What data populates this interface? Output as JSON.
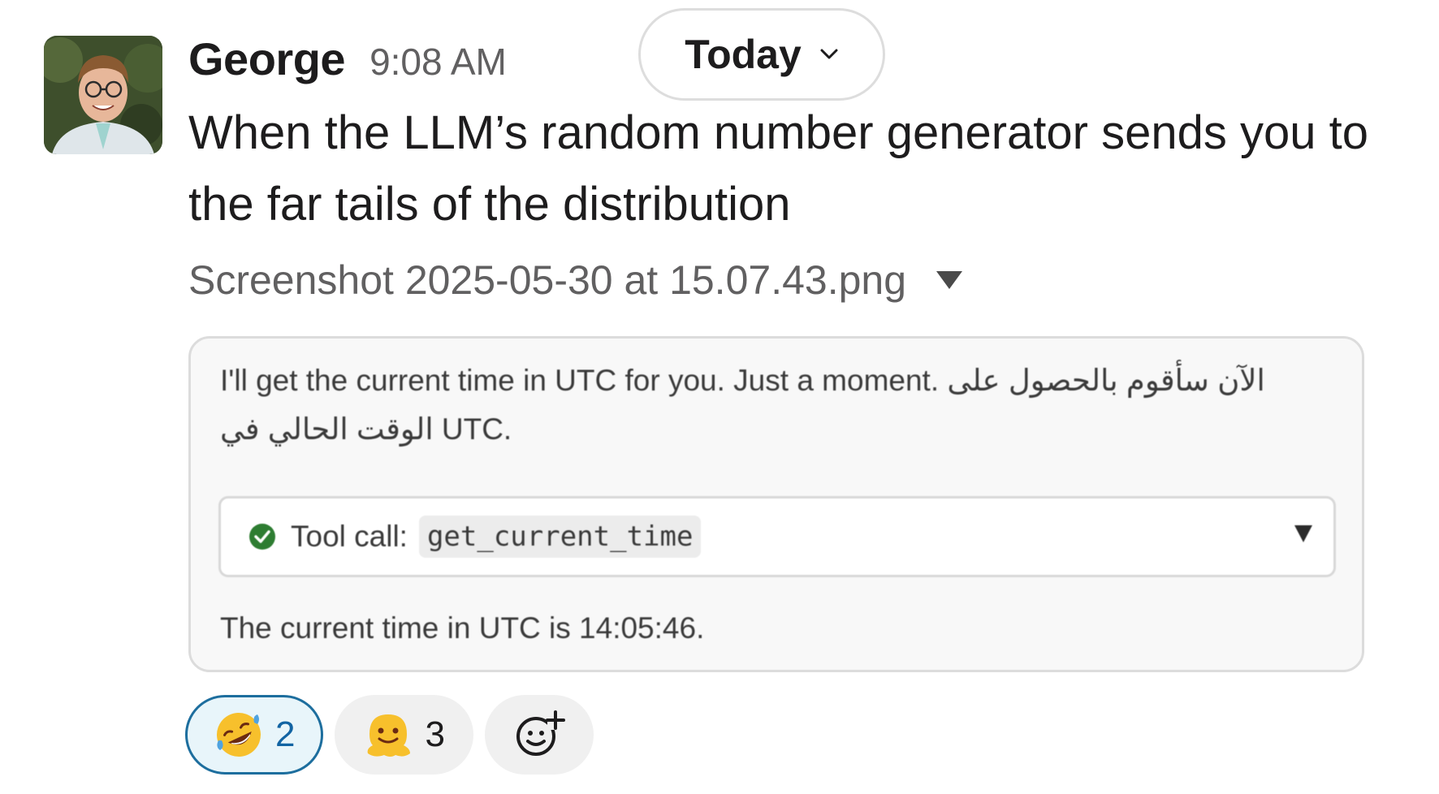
{
  "message": {
    "author": "George",
    "timestamp": "9:08 AM",
    "text": "When the LLM’s random number generator sends you to the far tails of the distribution"
  },
  "date_divider": {
    "label": "Today"
  },
  "attachment": {
    "file_name": "Screenshot 2025-05-30 at 15.07.43.png",
    "preview": {
      "intro_text": "I'll get the current time in UTC for you. Just a moment. الآن سأقوم بالحصول على الوقت الحالي في UTC.",
      "tool_call_label": "Tool call:",
      "tool_call_name": "get_current_time",
      "result_text": "The current time in UTC is 14:05:46."
    }
  },
  "reactions": [
    {
      "emoji": "rolling-on-floor-laughing",
      "count": "2",
      "reacted_by_me": true
    },
    {
      "emoji": "melting-face",
      "count": "3",
      "reacted_by_me": false
    }
  ],
  "colors": {
    "text_primary": "#1d1c1d",
    "text_secondary": "#616061",
    "reaction_active_border": "#1d6e9e",
    "reaction_active_bg": "#e8f5fa",
    "reaction_active_count": "#1264a3",
    "success_green": "#2e7d32"
  }
}
